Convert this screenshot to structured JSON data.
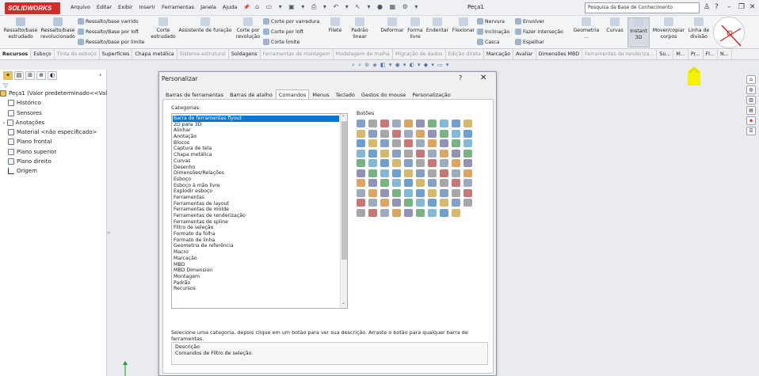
{
  "app": {
    "logo": "SOLIDWORKS",
    "doc_title": "Peça1",
    "search_placeholder": "Pesquisa da Base de Conhecimento"
  },
  "menu": [
    "Arquivo",
    "Editar",
    "Exibir",
    "Inserir",
    "Ferramentas",
    "Janela",
    "Ajuda"
  ],
  "ribbon": {
    "btn1": "Ressalto/base\nestrudado",
    "btn2": "Ressalto/base\nrevolucionado",
    "small1": "Ressalto/base varrido",
    "small2": "Ressalto/Base por loft",
    "small3": "Ressalto/base por limite",
    "btn3": "Corte\nestrudado",
    "btn4": "Assistente de furação",
    "btn5": "Corte por\nrevolução",
    "small4": "Corte por varredura",
    "small5": "Corte por loft",
    "small6": "Corte limite",
    "btn6": "Filete",
    "btn7": "Padrão linear",
    "btn8": "Deformar",
    "btn9": "Forma\nlivre",
    "btn10": "Endentar",
    "btn11": "Flexionar",
    "small7": "Nervura",
    "small8": "Inclinação",
    "small9": "Casca",
    "small10": "Envolver",
    "small11": "Fazer interseção",
    "small12": "Espelhar",
    "btn12": "Geometria ...",
    "btn13": "Curvas",
    "btn14": "Instant\n3D",
    "btn15": "Mover/copiar\ncorpos",
    "btn16": "Linha de\ndivisão"
  },
  "cmtabs": [
    "Recursos",
    "Esboço",
    "Tinta de esboço",
    "Superfícies",
    "Chapa metálica",
    "Sistema estrutural",
    "Soldagens",
    "Ferramentas de moldagem",
    "Modelagem de malha",
    "Migração de dados",
    "Edição direta",
    "Marcação",
    "Avaliar",
    "Dimensões MBD",
    "Ferramentas de renderiza...",
    "Su...",
    "M...",
    "Pr...",
    "Fl...",
    "N..."
  ],
  "tree": [
    "Peça1  (Valor predeterminado<<Valo",
    "Histórico",
    "Sensores",
    "Anotações",
    "Material <não especificado>",
    "Plano frontal",
    "Plano superior",
    "Plano direito",
    "Origem"
  ],
  "dialog": {
    "title": "Personalizar",
    "help": "?",
    "close": "✕",
    "tabs": [
      "Barras de ferramentas",
      "Barras de atalho",
      "Comandos",
      "Menus",
      "Teclado",
      "Gestos do mouse",
      "Personalização"
    ],
    "categories_label": "Categorias:",
    "categories": [
      "Barra de ferramentas flyout",
      "2D para 3D",
      "Alinhar",
      "Anotação",
      "Blocos",
      "Captura de tela",
      "Chapa metálica",
      "Curvas",
      "Desenho",
      "Dimensões/Relações",
      "Esboço",
      "Esboço à mão livre",
      "Explodir esboço",
      "Ferramentas",
      "Ferramentas de layout",
      "Ferramentas de molde",
      "Ferramentas de renderização",
      "Ferramentas de spline",
      "Filtro de seleção",
      "Formato da folha",
      "Formato de linha",
      "Geometria de referência",
      "Macro",
      "Marcação",
      "MBD",
      "MBD Dimension",
      "Montagem",
      "Padrão",
      "Recursos"
    ],
    "buttons_label": "Botões",
    "help_text": "Selecione uma categoria, depois clique em um botão para ver sua descrição. Arraste o botão para qualquer barra de ferramentas.",
    "desc_label": "Descrição",
    "desc_value": "Comandos de Filtro de seleção."
  },
  "colors": {
    "accent": "#0078d7",
    "logo": "#d32a2a",
    "highlight": "#f3f200"
  }
}
